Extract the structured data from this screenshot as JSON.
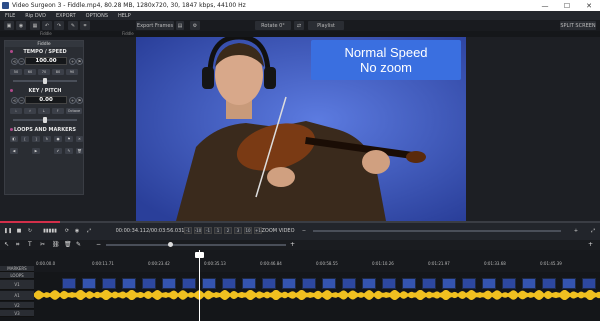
{
  "window": {
    "title": "Video Surgeon 3 - Fiddle.mp4, 80.28 MB, 1280x720, 30, 1847 kbps, 44100 Hz",
    "controls": [
      "—",
      "☐",
      "✕"
    ]
  },
  "menu": [
    "FILE",
    "Rip DVD",
    "EXPORT",
    "OPTIONS",
    "HELP"
  ],
  "toolbar": {
    "export_frames": "Export Frames",
    "rotate": "Rotate 0°",
    "playlist": "Playlist",
    "split_screen": "SPLIT SCREEN"
  },
  "subbar": {
    "left_tab": "Fiddle",
    "center_tab": "Fiddle"
  },
  "panel": {
    "tempo_title": "TEMPO / SPEED",
    "tempo_value": "100.00",
    "tempo_chips": [
      "50",
      "60",
      "70",
      "80",
      "90"
    ],
    "key_title": "KEY / PITCH",
    "key_value": "0.00",
    "key_chips": [
      "Octave"
    ],
    "loops_title": "LOOPS AND MARKERS"
  },
  "overlay": {
    "line1": "Normal Speed",
    "line2": "No zoom"
  },
  "transport": {
    "time": "00:00:34.112/00:03:56.031",
    "steps": [
      "-1",
      "-10",
      "-1",
      "1",
      "2",
      "3",
      "10",
      "+1"
    ],
    "zoom_label": "ZOOM VIDEO"
  },
  "ruler": {
    "ticks": [
      "0:00.00.0",
      "0:00:11.71",
      "0:00:23.42",
      "0:00:35.13",
      "0:00:46.84",
      "0:00:58.55",
      "0:01:10.26",
      "0:01:21.97",
      "0:01:33.68",
      "0:01:45.39",
      "0:01:57.10",
      "0:02:08.81",
      "0:02:20.52",
      "0:02:32.23",
      "0:02:43.94",
      "0:02:55.65",
      "0:03:07.36",
      "0:03:19.07",
      "0:03:30.78",
      "0:03:42.49"
    ]
  },
  "tracks": {
    "labels": [
      "MARKERS",
      "LOOPS",
      "V1",
      "A1",
      "V2",
      "V3"
    ]
  },
  "colors": {
    "accent": "#3a6fe0",
    "progress": "#d32f4a",
    "panel_dot": "#b24a8c"
  }
}
